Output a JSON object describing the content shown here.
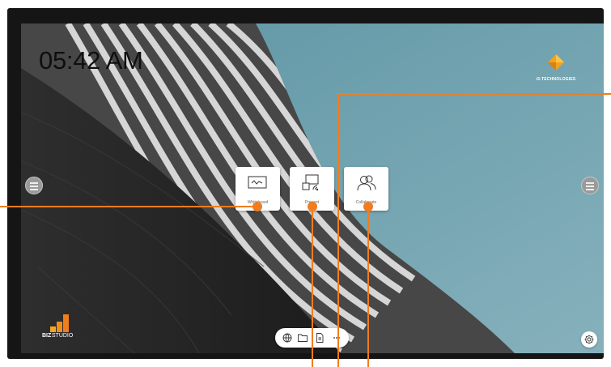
{
  "clock": {
    "time": "05:42 AM"
  },
  "brand": {
    "name": "i3-TECHNOLOGIES"
  },
  "apps": [
    {
      "label": "Whiteboard",
      "icon": "whiteboard-icon"
    },
    {
      "label": "Present",
      "icon": "present-icon"
    },
    {
      "label": "Collaborate",
      "icon": "collaborate-icon"
    }
  ],
  "studio": {
    "bold": "BIZ",
    "rest": "STUDIO"
  },
  "dock": {
    "items": [
      "globe-icon",
      "folder-icon",
      "document-icon",
      "more-icon"
    ]
  },
  "colors": {
    "accent": "#f07d1e",
    "sky": "#6fa0ad",
    "bezel": "#151515"
  }
}
